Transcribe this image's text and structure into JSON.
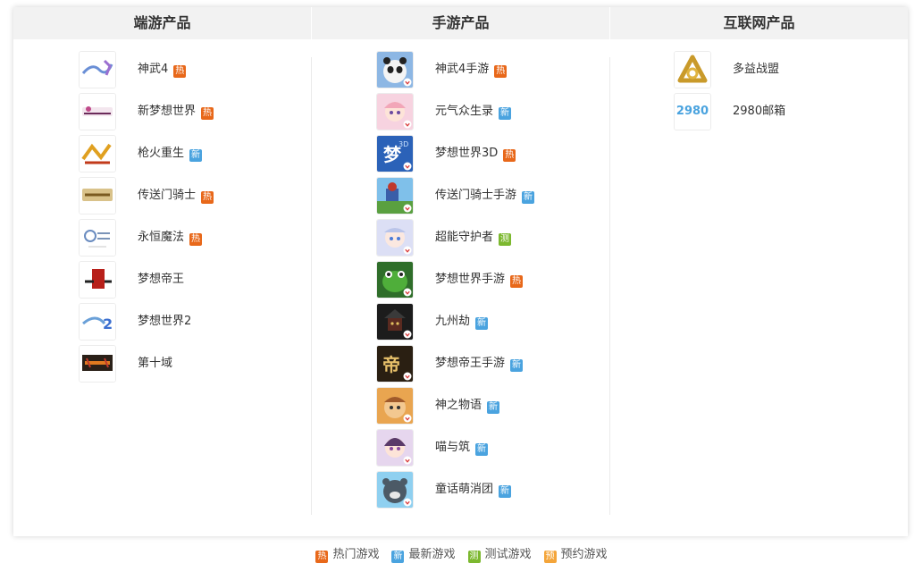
{
  "headers": {
    "pc": "端游产品",
    "mobile": "手游产品",
    "internet": "互联网产品"
  },
  "tag_colors": {
    "hot": "#e8681a",
    "new": "#4aa3df",
    "test": "#7cb82f",
    "reserve": "#f4a53a"
  },
  "pc_games": [
    {
      "name": "神武4",
      "tag_text": "热",
      "tag": "hot",
      "icon": "shenwu4-logo-icon"
    },
    {
      "name": "新梦想世界",
      "tag_text": "热",
      "tag": "hot",
      "icon": "xinmengxiang-logo-icon"
    },
    {
      "name": "枪火重生",
      "tag_text": "新",
      "tag": "new",
      "icon": "qianghuo-logo-icon"
    },
    {
      "name": "传送门骑士",
      "tag_text": "热",
      "tag": "hot",
      "icon": "portal-knights-logo-icon"
    },
    {
      "name": "永恒魔法",
      "tag_text": "热",
      "tag": "hot",
      "icon": "yongheng-logo-icon"
    },
    {
      "name": "梦想帝王",
      "tag_text": "",
      "tag": "",
      "icon": "mengxiang-diwang-logo-icon"
    },
    {
      "name": "梦想世界2",
      "tag_text": "",
      "tag": "",
      "icon": "mengxiang2-logo-icon"
    },
    {
      "name": "第十域",
      "tag_text": "",
      "tag": "",
      "icon": "dishiyu-logo-icon"
    }
  ],
  "mobile_games": [
    {
      "name": "神武4手游",
      "tag_text": "热",
      "tag": "hot",
      "icon": "panda-app-icon"
    },
    {
      "name": "元气众生录",
      "tag_text": "新",
      "tag": "new",
      "icon": "anime-girl-app-icon"
    },
    {
      "name": "梦想世界3D",
      "tag_text": "热",
      "tag": "hot",
      "icon": "mengxiang3d-app-icon"
    },
    {
      "name": "传送门骑士手游",
      "tag_text": "新",
      "tag": "new",
      "icon": "portal-knights-app-icon"
    },
    {
      "name": "超能守护者",
      "tag_text": "测",
      "tag": "test",
      "icon": "guardian-app-icon"
    },
    {
      "name": "梦想世界手游",
      "tag_text": "热",
      "tag": "hot",
      "icon": "frog-app-icon"
    },
    {
      "name": "九州劫",
      "tag_text": "新",
      "tag": "new",
      "icon": "samurai-app-icon"
    },
    {
      "name": "梦想帝王手游",
      "tag_text": "新",
      "tag": "new",
      "icon": "diwang-app-icon"
    },
    {
      "name": "神之物语",
      "tag_text": "新",
      "tag": "new",
      "icon": "shenzhi-app-icon"
    },
    {
      "name": "喵与筑",
      "tag_text": "新",
      "tag": "new",
      "icon": "cat-girl-app-icon"
    },
    {
      "name": "童话萌消团",
      "tag_text": "新",
      "tag": "new",
      "icon": "bear-app-icon"
    }
  ],
  "internet_products": [
    {
      "name": "多益战盟",
      "tag_text": "",
      "tag": "",
      "icon": "duoyi-knot-logo-icon"
    },
    {
      "name": "2980邮箱",
      "tag_text": "",
      "tag": "",
      "icon": "2980-mail-logo-icon",
      "logo_text": "2980"
    }
  ],
  "legend": [
    {
      "tag_text": "热",
      "tag": "hot",
      "label": "热门游戏"
    },
    {
      "tag_text": "新",
      "tag": "new",
      "label": "最新游戏"
    },
    {
      "tag_text": "测",
      "tag": "test",
      "label": "测试游戏"
    },
    {
      "tag_text": "预",
      "tag": "reserve",
      "label": "预约游戏"
    }
  ]
}
